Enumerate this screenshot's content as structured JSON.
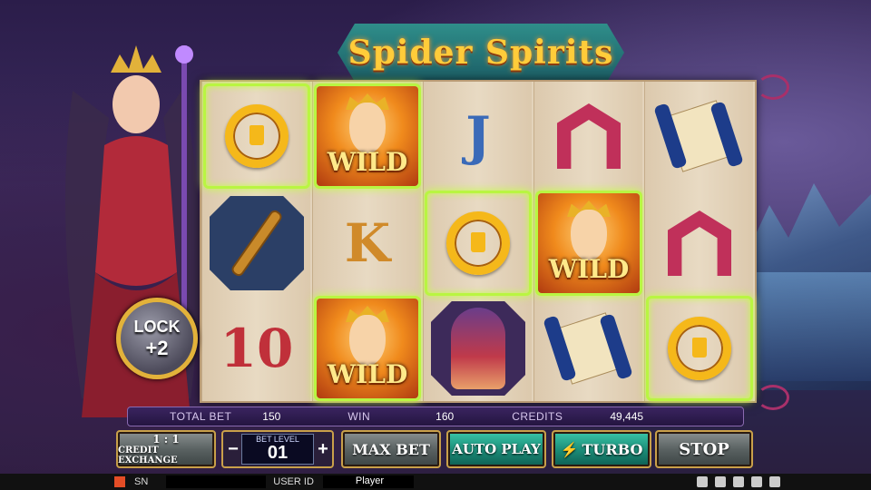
{
  "game": {
    "title": "Spider Spirits",
    "lock_badge": {
      "line1": "LOCK",
      "line2": "+2"
    }
  },
  "reels": {
    "wild_label": "WILD",
    "columns": [
      [
        {
          "symbol": "Q",
          "win": true
        },
        {
          "symbol": "artifact",
          "win": false
        },
        {
          "symbol": "10",
          "win": false
        }
      ],
      [
        {
          "symbol": "WILD",
          "win": true
        },
        {
          "symbol": "K",
          "win": false
        },
        {
          "symbol": "WILD",
          "win": true
        }
      ],
      [
        {
          "symbol": "J",
          "win": false
        },
        {
          "symbol": "Q",
          "win": true
        },
        {
          "symbol": "princess",
          "win": false
        }
      ],
      [
        {
          "symbol": "A",
          "win": false
        },
        {
          "symbol": "WILD",
          "win": true
        },
        {
          "symbol": "scroll",
          "win": false
        }
      ],
      [
        {
          "symbol": "scroll",
          "win": false
        },
        {
          "symbol": "A",
          "win": false
        },
        {
          "symbol": "Q",
          "win": true
        }
      ]
    ]
  },
  "info_bar": {
    "total_bet_label": "TOTAL BET",
    "total_bet_value": "150",
    "win_label": "WIN",
    "win_value": "160",
    "credits_label": "CREDITS",
    "credits_value": "49,445"
  },
  "controls": {
    "credit_exchange_ratio": "1 : 1",
    "credit_exchange_label": "CREDIT EXCHANGE",
    "bet_level_label": "BET LEVEL",
    "bet_level_value": "01",
    "minus": "−",
    "plus": "+",
    "max_bet": "MAX BET",
    "auto_play": "AUTO PLAY",
    "turbo": "TURBO",
    "turbo_icon": "⚡",
    "stop": "STOP"
  },
  "footer": {
    "sn_label": "SN",
    "user_id_label": "USER ID",
    "player_value": "Player"
  },
  "colors": {
    "win_highlight": "#b9f542",
    "accent_gold": "#c9a04a",
    "q_gold": "#f5b81a",
    "a_red": "#c0305a"
  }
}
